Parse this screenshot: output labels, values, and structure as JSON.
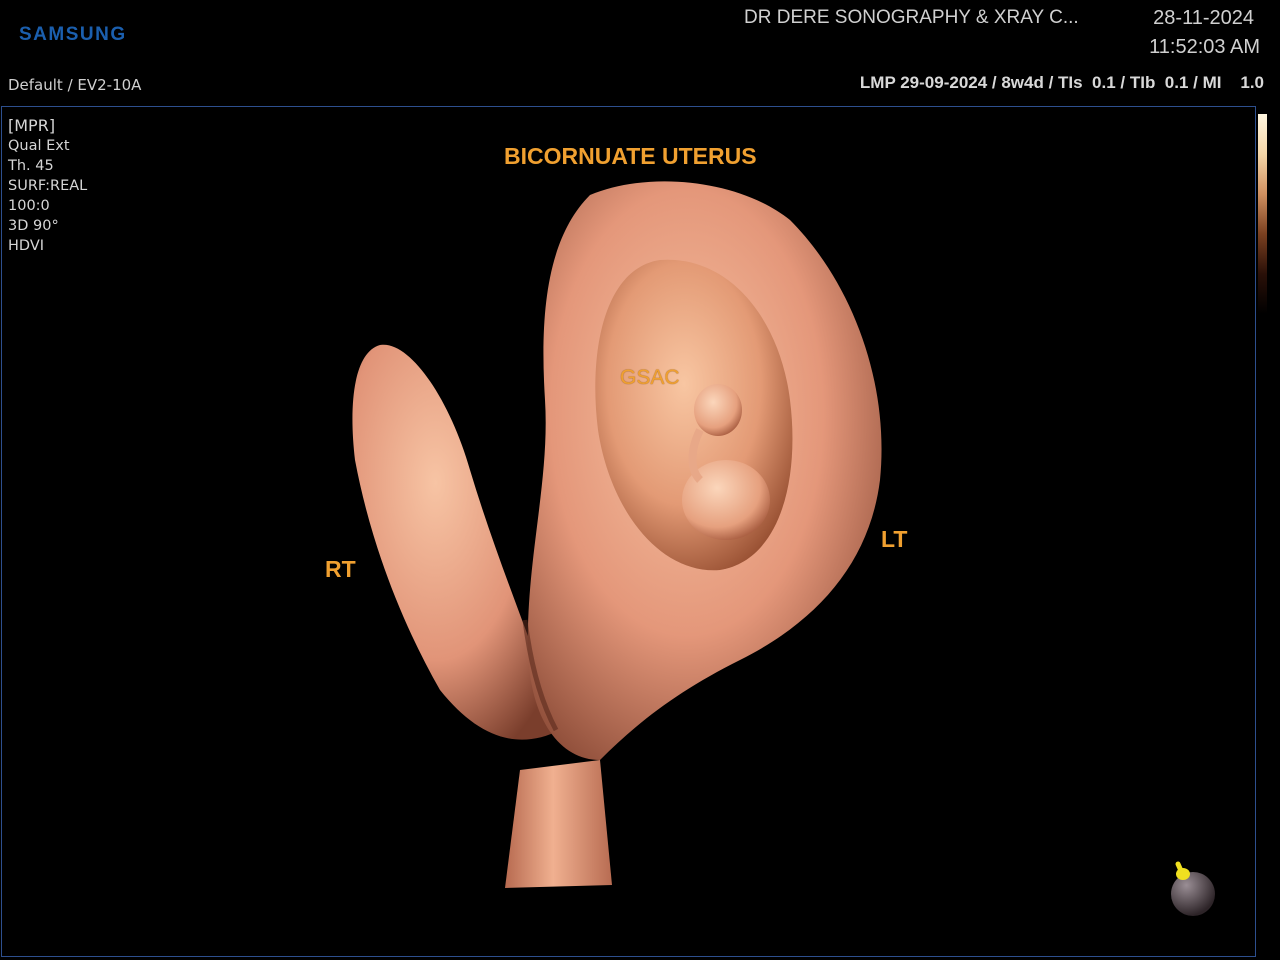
{
  "header": {
    "brand": "SAMSUNG",
    "clinic": "DR DERE SONOGRAPHY & XRAY C...",
    "date": "28-11-2024",
    "time": "11:52:03 AM",
    "preset": "Default / EV2-10A",
    "params": "LMP 29-09-2024 / 8w4d / TIs  0.1 / TIb  0.1 / MI    1.0"
  },
  "imaging_info": [
    "[MPR]",
    "Qual Ext",
    "Th. 45",
    "SURF:REAL",
    "100:0",
    "3D 90°",
    "HDVI"
  ],
  "annotations": {
    "title": "BICORNUATE UTERUS",
    "right": "RT",
    "left": "LT",
    "sac": "GSAC"
  },
  "colors": {
    "label": "#f0a030",
    "brand": "#1b5fae",
    "tissue": "#e8a07a",
    "frame": "#2d4f8e"
  }
}
